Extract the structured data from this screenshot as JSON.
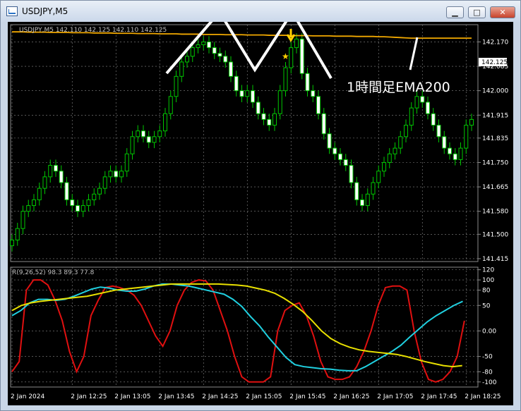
{
  "window": {
    "title": "USDJPY,M5",
    "min_glyph": "▁",
    "max_glyph": "□",
    "close_glyph": "✕"
  },
  "info_line": "USDJPY,M5  142.110 142.125 142.110 142.125",
  "annotation": "1時間足EMA200",
  "price_axis": {
    "ticks": [
      "142.170",
      "142.085",
      "142.000",
      "141.915",
      "141.835",
      "141.750",
      "141.665",
      "141.580",
      "141.500",
      "141.415"
    ],
    "tick_values": [
      142.17,
      142.085,
      142.0,
      141.915,
      141.835,
      141.75,
      141.665,
      141.58,
      141.5,
      141.415
    ],
    "current_label": "142.125"
  },
  "indicator": {
    "label": "R(9,26,52) 98.3 89.3 77.8",
    "ticks": [
      "120",
      "100",
      "80",
      "50",
      "0.00",
      "-50",
      "-80",
      "-100"
    ],
    "tick_values": [
      120,
      100,
      80,
      50,
      0,
      -50,
      -80,
      -100
    ]
  },
  "time_axis": {
    "labels": [
      "2 Jan 2024",
      "2 Jan 12:25",
      "2 Jan 13:05",
      "2 Jan 13:45",
      "2 Jan 14:25",
      "2 Jan 15:05",
      "2 Jan 15:45",
      "2 Jan 16:25",
      "2 Jan 17:05",
      "2 Jan 17:45",
      "2 Jan 18:25"
    ],
    "label_bars": [
      0,
      11,
      19,
      27,
      35,
      43,
      51,
      59,
      67,
      75,
      83
    ]
  },
  "colors": {
    "background": "#000000",
    "grid": "#8a8a8a",
    "candle": "#00c800",
    "ema200": "#f2a900",
    "fast_line": "#e01010",
    "mid_line": "#20d0e0",
    "slow_line": "#e8e000",
    "annotation": "#ffffff",
    "arrow": "#ffd000"
  },
  "chart_data": [
    {
      "type": "candlestick",
      "title": "USDJPY,M5",
      "ylim": [
        141.405,
        142.23
      ],
      "x_labels": [
        "2 Jan 2024",
        "2 Jan 12:25",
        "2 Jan 13:05",
        "2 Jan 13:45",
        "2 Jan 14:25",
        "2 Jan 15:05",
        "2 Jan 15:45",
        "2 Jan 16:25",
        "2 Jan 17:05",
        "2 Jan 17:45",
        "2 Jan 18:25"
      ],
      "closes": [
        141.48,
        141.52,
        141.58,
        141.6,
        141.62,
        141.66,
        141.7,
        141.74,
        141.72,
        141.68,
        141.62,
        141.6,
        141.58,
        141.6,
        141.62,
        141.64,
        141.66,
        141.7,
        141.72,
        141.7,
        141.72,
        141.78,
        141.84,
        141.86,
        141.84,
        141.82,
        141.84,
        141.86,
        141.92,
        141.98,
        142.05,
        142.1,
        142.12,
        142.15,
        142.16,
        142.17,
        142.15,
        142.13,
        142.12,
        142.1,
        142.05,
        142.0,
        141.98,
        142.0,
        141.96,
        141.92,
        141.9,
        141.88,
        141.92,
        142.0,
        142.08,
        142.15,
        142.18,
        142.06,
        142.0,
        141.98,
        141.92,
        141.85,
        141.8,
        141.78,
        141.76,
        141.74,
        141.68,
        141.62,
        141.6,
        141.64,
        141.68,
        141.72,
        141.75,
        141.78,
        141.8,
        141.84,
        141.88,
        141.94,
        141.98,
        141.96,
        141.92,
        141.88,
        141.84,
        141.8,
        141.78,
        141.76,
        141.8,
        141.88,
        141.9
      ],
      "series": [
        {
          "name": "1時間足EMA200",
          "values": [
            142.205,
            142.205,
            142.205,
            142.204,
            142.204,
            142.204,
            142.204,
            142.203,
            142.203,
            142.203,
            142.203,
            142.202,
            142.202,
            142.202,
            142.202,
            142.201,
            142.201,
            142.201,
            142.201,
            142.2,
            142.2,
            142.2,
            142.2,
            142.199,
            142.199,
            142.199,
            142.199,
            142.198,
            142.198,
            142.198,
            142.198,
            142.197,
            142.197,
            142.197,
            142.197,
            142.196,
            142.196,
            142.196,
            142.196,
            142.195,
            142.195,
            142.195,
            142.195,
            142.194,
            142.194,
            142.194,
            142.194,
            142.193,
            142.193,
            142.193,
            142.193,
            142.192,
            142.192,
            142.192,
            142.192,
            142.191,
            142.191,
            142.191,
            142.191,
            142.19,
            142.19,
            142.19,
            142.19,
            142.189,
            142.189,
            142.189,
            142.189,
            142.188,
            142.188,
            142.187,
            142.186,
            142.185,
            142.184,
            142.183,
            142.183,
            142.183,
            142.183,
            142.183,
            142.183,
            142.183,
            142.183,
            142.183,
            142.183,
            142.183,
            142.183
          ]
        }
      ]
    },
    {
      "type": "line",
      "title": "R(9,26,52) 98.3 89.3 77.8",
      "ylim": [
        -110,
        125
      ],
      "x_labels": [
        "2 Jan 2024",
        "2 Jan 12:25",
        "2 Jan 13:05",
        "2 Jan 13:45",
        "2 Jan 14:25",
        "2 Jan 15:05",
        "2 Jan 15:45",
        "2 Jan 16:25",
        "2 Jan 17:05",
        "2 Jan 17:45",
        "2 Jan 18:25"
      ],
      "series": [
        {
          "name": "R(9)",
          "values": [
            -80,
            -60,
            80,
            100,
            100,
            90,
            60,
            20,
            -40,
            -80,
            -50,
            30,
            60,
            85,
            88,
            85,
            80,
            70,
            50,
            20,
            -10,
            -30,
            0,
            50,
            80,
            95,
            100,
            98,
            80,
            40,
            0,
            -50,
            -90,
            -100,
            -100,
            -100,
            -90,
            0,
            40,
            50,
            55,
            30,
            -10,
            -60,
            -90,
            -95,
            -95,
            -90,
            -70,
            -40,
            0,
            50,
            85,
            88,
            88,
            80,
            0,
            -60,
            -95,
            -100,
            -95,
            -80,
            -50,
            20
          ]
        },
        {
          "name": "R(26)",
          "values": [
            30,
            40,
            55,
            62,
            62,
            60,
            62,
            68,
            75,
            82,
            86,
            84,
            80,
            78,
            78,
            82,
            88,
            92,
            92,
            90,
            88,
            84,
            80,
            76,
            72,
            62,
            48,
            28,
            10,
            -12,
            -32,
            -52,
            -66,
            -70,
            -72,
            -74,
            -75,
            -77,
            -78,
            -78,
            -70,
            -60,
            -50,
            -40,
            -28,
            -12,
            3,
            18,
            30,
            40,
            50,
            58
          ]
        },
        {
          "name": "R(52)",
          "values": [
            40,
            50,
            55,
            58,
            60,
            62,
            64,
            66,
            68,
            72,
            76,
            80,
            82,
            84,
            86,
            88,
            90,
            92,
            92,
            92,
            92,
            92,
            92,
            91,
            90,
            88,
            84,
            80,
            74,
            64,
            52,
            38,
            20,
            0,
            -15,
            -25,
            -32,
            -37,
            -40,
            -42,
            -44,
            -46,
            -50,
            -55,
            -60,
            -64,
            -68,
            -70,
            -68
          ]
        }
      ]
    }
  ]
}
